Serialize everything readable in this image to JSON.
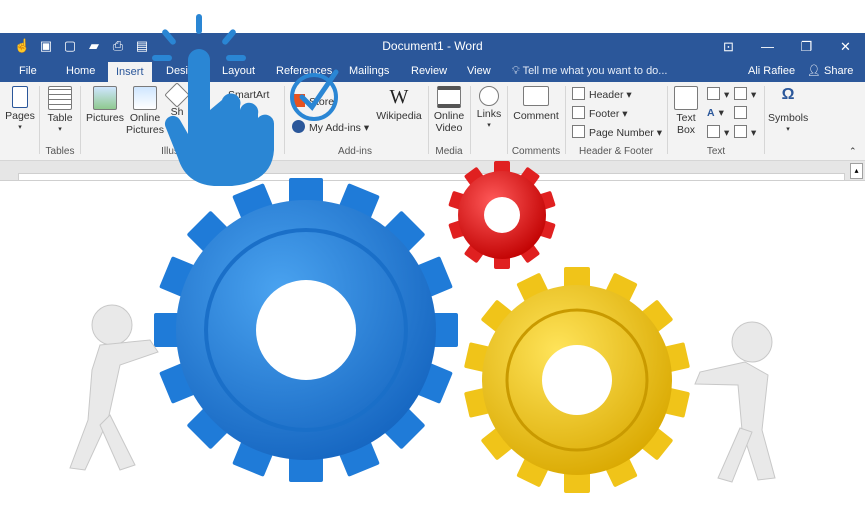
{
  "window": {
    "title": "Document1 - Word",
    "controls": [
      "restore-ribbon",
      "minimize",
      "maximize",
      "close"
    ]
  },
  "quick_access": {
    "icons": [
      "touch-mode-icon",
      "save-icon",
      "new-document-icon",
      "open-folder-icon",
      "print-icon",
      "print-preview-icon"
    ]
  },
  "tabs": [
    {
      "label": "File"
    },
    {
      "label": "Home"
    },
    {
      "label": "Insert",
      "active": true
    },
    {
      "label": "Design"
    },
    {
      "label": "Layout"
    },
    {
      "label": "References"
    },
    {
      "label": "Mailings"
    },
    {
      "label": "Review"
    },
    {
      "label": "View"
    }
  ],
  "tell_me": "Tell me what you want to do...",
  "user": "Ali Rafiee",
  "share_label": "Share",
  "ribbon": {
    "pages": "Pages",
    "table": "Table",
    "tables_group": "Tables",
    "pictures": "Pictures",
    "online_pictures": [
      "Online",
      "Pictures"
    ],
    "shapes": "Sh",
    "smartart": "SmartArt",
    "illustrations_group": "Illus",
    "store": "Store",
    "my_addins": "My Add-ins",
    "wikipedia": "Wikipedia",
    "addins_group": "Add-ins",
    "online_video": [
      "Online",
      "Video"
    ],
    "media_group": "Media",
    "links": "Links",
    "comment": "Comment",
    "comments_group": "Comments",
    "header": "Header",
    "footer": "Footer",
    "page_number": "Page Number",
    "header_footer_group": "Header & Footer",
    "text_box": [
      "Text",
      "Box"
    ],
    "text_group": "Text",
    "symbols": "Symbols",
    "omega": "Ω",
    "wiki_glyph": "W"
  },
  "colors": {
    "word_blue": "#2b579a",
    "ribbon_bg": "#f3f3f3",
    "gear_blue": "#1f7bd8",
    "gear_yellow": "#f0c419",
    "gear_red": "#e02020",
    "hand_blue": "#2a86d4"
  }
}
